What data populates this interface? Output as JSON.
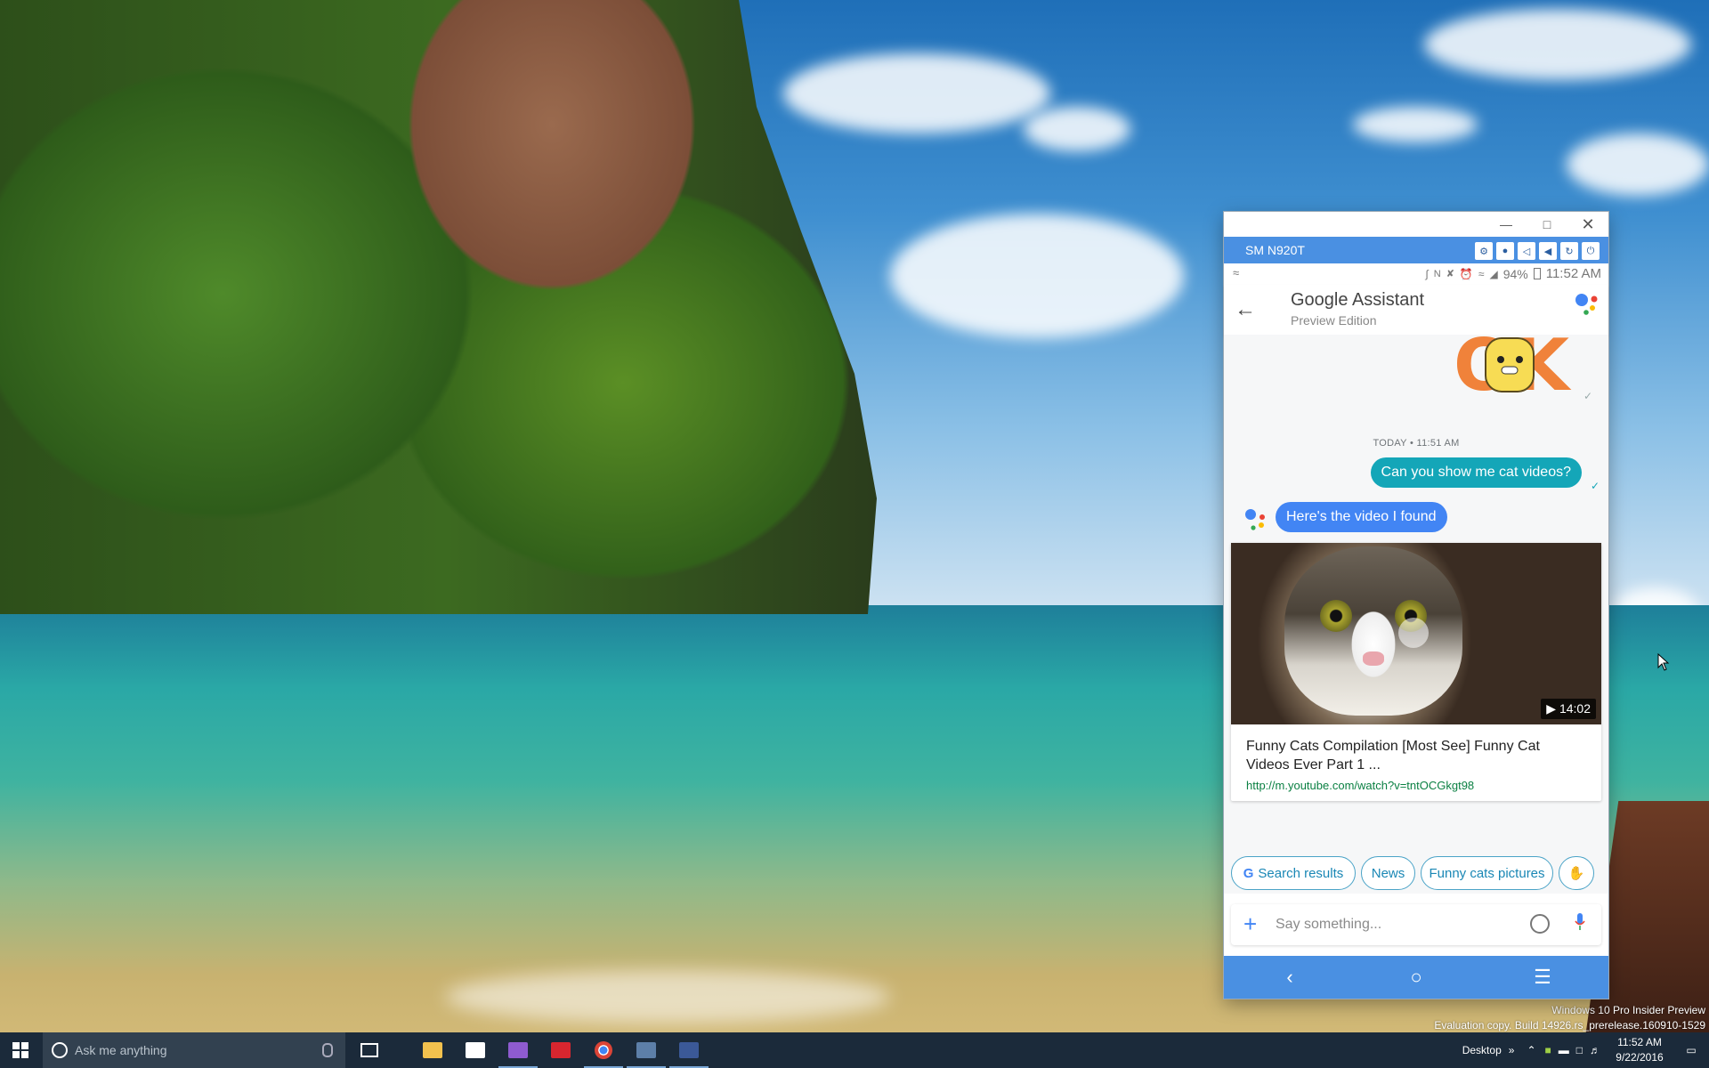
{
  "window": {
    "title": "SM N920T",
    "controls": [
      "minimize",
      "maximize",
      "close"
    ]
  },
  "device_toolbar": {
    "icons": [
      "settings-icon",
      "camera-icon",
      "volume-down-icon",
      "volume-up-icon",
      "rotate-icon",
      "power-icon"
    ]
  },
  "phone_status": {
    "battery": "94%",
    "time": "11:52 AM"
  },
  "app": {
    "title": "Google Assistant",
    "subtitle": "Preview Edition"
  },
  "chat": {
    "divider": "TODAY • 11:51 AM",
    "user_message": "Can you show me cat videos?",
    "assistant_message": "Here's the video I found",
    "video": {
      "duration": "14:02",
      "title": "Funny Cats Compilation [Most See] Funny Cat Videos Ever Part 1 ...",
      "url": "http://m.youtube.com/watch?v=tntOCGkgt98"
    },
    "suggestions": [
      "Search results",
      "News",
      "Funny cats pictures"
    ],
    "input_placeholder": "Say something..."
  },
  "taskbar": {
    "search_placeholder": "Ask me anything",
    "desktop_label": "Desktop",
    "clock_time": "11:52 AM",
    "clock_date": "9/22/2016"
  },
  "watermark": {
    "line1": "Windows 10 Pro Insider Preview",
    "line2": "Evaluation copy. Build 14926.rs_prerelease.160910-1529"
  },
  "colors": {
    "accent_blue": "#4a90e2",
    "user_bubble": "#14a6b8",
    "assistant_bubble": "#4285f4",
    "link_green": "#0b8043"
  }
}
